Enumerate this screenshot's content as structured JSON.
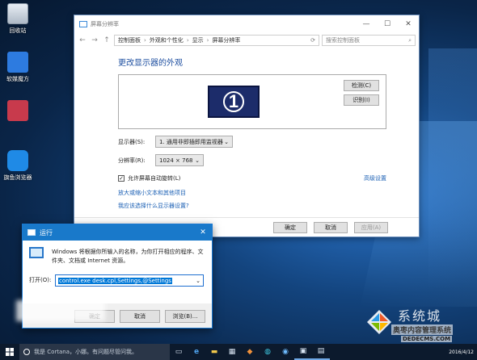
{
  "desktop": {
    "icons": [
      {
        "label": "回收站",
        "color": "#cfd8e3"
      },
      {
        "label": "软媒魔方",
        "color": "#2d7be0"
      },
      {
        "label": "",
        "color": "#c83a4c"
      },
      {
        "label": "旗鱼浏览器",
        "color": "#1f8ae6"
      }
    ]
  },
  "display_window": {
    "title": "屏幕分辨率",
    "controls": {
      "minimize": "—",
      "maximize": "☐",
      "close": "✕"
    },
    "nav": {
      "back": "←",
      "forward": "→",
      "up": "↑"
    },
    "breadcrumb": [
      "控制面板",
      "外观和个性化",
      "显示",
      "屏幕分辨率"
    ],
    "search_placeholder": "搜索控制面板",
    "heading": "更改显示器的外观",
    "monitor_number": "1",
    "detect_label": "检测(C)",
    "identify_label": "识别(I)",
    "display_label": "显示器(S):",
    "display_value": "1. 通用非即插即用监视器",
    "resolution_label": "分辨率(R):",
    "resolution_value": "1024 × 768",
    "auto_rotate_label": "允许屏幕自动旋转(L)",
    "advanced_link": "高级设置",
    "text_size_link": "放大或缩小文本和其他项目",
    "choose_link": "我应该选择什么显示器设置?",
    "ok_label": "确定",
    "cancel_label": "取消",
    "apply_label": "应用(A)"
  },
  "run_dialog": {
    "title": "运行",
    "close": "✕",
    "description": "Windows 将根据你所输入的名称，为你打开相应的程序、文件夹、文档或 Internet 资源。",
    "open_label": "打开(O):",
    "command": "control.exe desk.cpl,Settings,@Settings",
    "ok_label": "确定",
    "cancel_label": "取消",
    "browse_label": "浏览(B)..."
  },
  "taskbar": {
    "search_text": "我是 Cortana，小娜。有问题尽管问我。",
    "clock_date": "2016/4/12"
  },
  "watermark": {
    "brand": "系统城",
    "subtitle": "奥枣内容管理系统",
    "url": "DEDECMS.COM"
  }
}
